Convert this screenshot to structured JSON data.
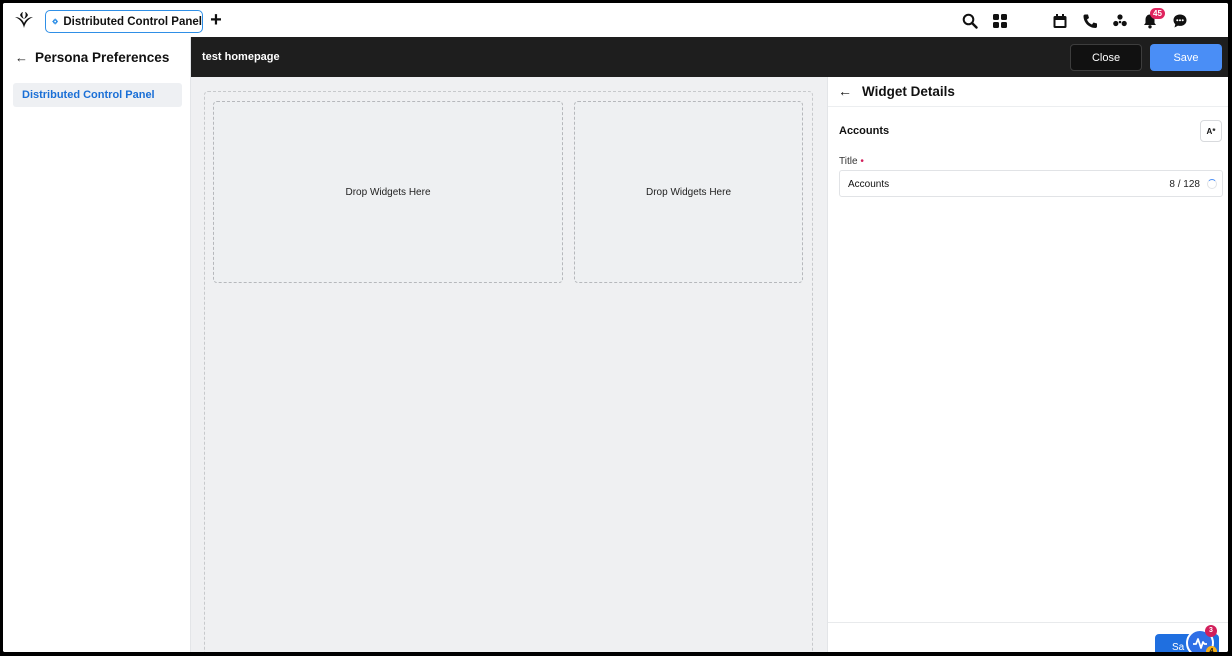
{
  "topbar": {
    "tab_label": "Distributed Control Panel",
    "add_tab": "+",
    "notification_count": "45",
    "icons": [
      "search-icon",
      "apps-grid-icon",
      "calendar-icon",
      "phone-icon",
      "community-icon",
      "bell-icon",
      "chat-icon"
    ]
  },
  "sidebar": {
    "back": "←",
    "title": "Persona Preferences",
    "items": [
      {
        "label": "Distributed Control Panel",
        "active": true
      }
    ]
  },
  "editor": {
    "page_name": "test homepage",
    "close_label": "Close",
    "save_label": "Save",
    "drop_zones": [
      "Drop Widgets Here",
      "Drop Widgets Here"
    ]
  },
  "widget_details": {
    "back": "←",
    "title": "Widget Details",
    "section": "Accounts",
    "translate_icon": "A*",
    "field_label": "Title",
    "required_mark": "•",
    "field_value": "Accounts",
    "char_count": "8 / 128",
    "footer_save_label": "Sa"
  },
  "activity": {
    "badge_count": "3",
    "secondary_count": "4"
  },
  "colors": {
    "accent": "#4a8ef6",
    "link": "#1a6fd6",
    "header_dark": "#1e1e1e",
    "badge": "#e0245e"
  }
}
